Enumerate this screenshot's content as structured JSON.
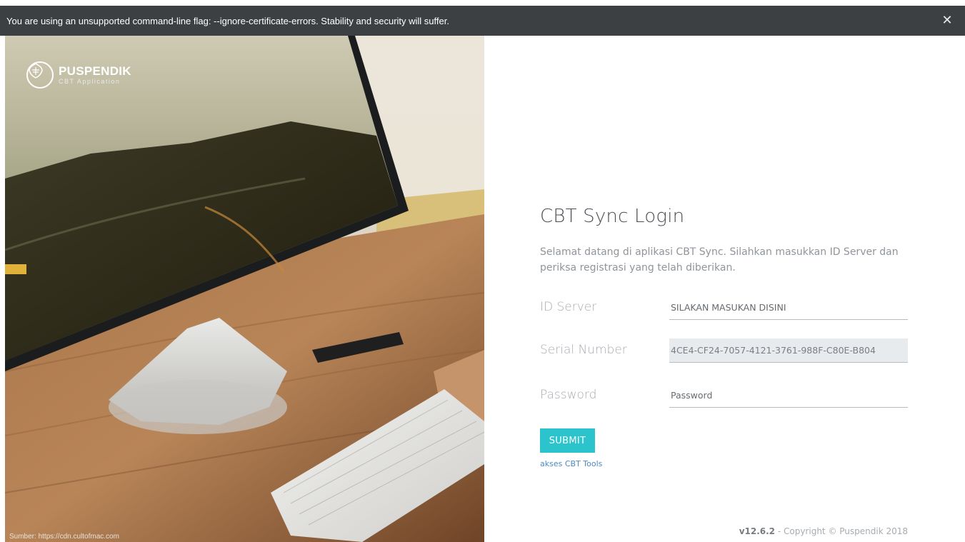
{
  "infobar": {
    "message": "You are using an unsupported command-line flag: --ignore-certificate-errors. Stability and security will suffer.",
    "close_glyph": "✕",
    "close_icon": "close-icon"
  },
  "hero": {
    "logo_title": "PUSPENDIK",
    "logo_subtitle": "CBT Application",
    "logo_icon": "emblem-icon",
    "source_caption": "Sumber: https://cdn.cultofmac.com"
  },
  "login": {
    "title": "CBT Sync Login",
    "description": "Selamat datang di aplikasi CBT Sync. Silahkan masukkan ID Server dan periksa registrasi yang telah diberikan.",
    "fields": [
      {
        "label": "ID Server",
        "value": "",
        "placeholder": "SILAKAN MASUKAN DISINI"
      },
      {
        "label": "Serial Number",
        "value": "4CE4-CF24-7057-4121-3761-988F-C80E-B804",
        "placeholder": ""
      },
      {
        "label": "Password",
        "value": "",
        "placeholder": "Password"
      }
    ],
    "submit_label": "SUBMIT",
    "tools_link": "akses CBT Tools"
  },
  "footer": {
    "version": "v12.6.2",
    "copyright": " - Copyright © Puspendik 2018"
  },
  "colors": {
    "infobar_bg": "#3d4043",
    "accent": "#2cc4cc",
    "link": "#4a8bc4"
  }
}
